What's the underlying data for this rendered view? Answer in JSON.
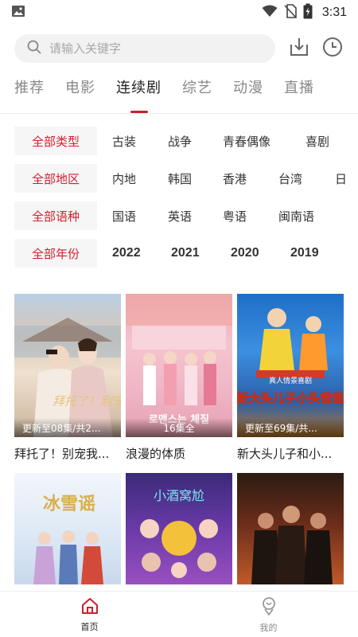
{
  "status_bar": {
    "time": "3:31"
  },
  "search": {
    "placeholder": "请输入关键字"
  },
  "tabs": [
    {
      "label": "推荐",
      "active": false
    },
    {
      "label": "电影",
      "active": false
    },
    {
      "label": "连续剧",
      "active": true
    },
    {
      "label": "综艺",
      "active": false
    },
    {
      "label": "动漫",
      "active": false
    },
    {
      "label": "直播",
      "active": false
    }
  ],
  "filters": [
    {
      "head": "全部类型",
      "options": [
        "古装",
        "战争",
        "青春偶像",
        "喜剧"
      ]
    },
    {
      "head": "全部地区",
      "options": [
        "内地",
        "韩国",
        "香港",
        "台湾",
        "日"
      ]
    },
    {
      "head": "全部语种",
      "options": [
        "国语",
        "英语",
        "粤语",
        "闽南语"
      ]
    },
    {
      "head": "全部年份",
      "options": [
        "2022",
        "2021",
        "2020",
        "2019"
      ]
    }
  ],
  "cards": [
    {
      "caption": "更新至08集/共2...",
      "title": "拜托了！别宠我..."
    },
    {
      "caption": "16集全",
      "title": "浪漫的体质"
    },
    {
      "caption": "更新至69集/共...",
      "title": "新大头儿子和小..."
    },
    {
      "caption": "",
      "title": ""
    },
    {
      "caption": "",
      "title": ""
    },
    {
      "caption": "",
      "title": ""
    }
  ],
  "poster_text": {
    "p1": "拜托了！别宠我",
    "p2": "로맨스는 체질",
    "p3": "新大头儿子小头爸爸",
    "p3_top": "真人情景喜剧",
    "p4": "冰雪谣",
    "p5": "小酒窝尬"
  },
  "bottom_nav": [
    {
      "label": "首页",
      "active": true
    },
    {
      "label": "我的",
      "active": false
    }
  ],
  "colors": {
    "accent": "#cc1f2e",
    "filter_bg": "#f6f6f6"
  }
}
